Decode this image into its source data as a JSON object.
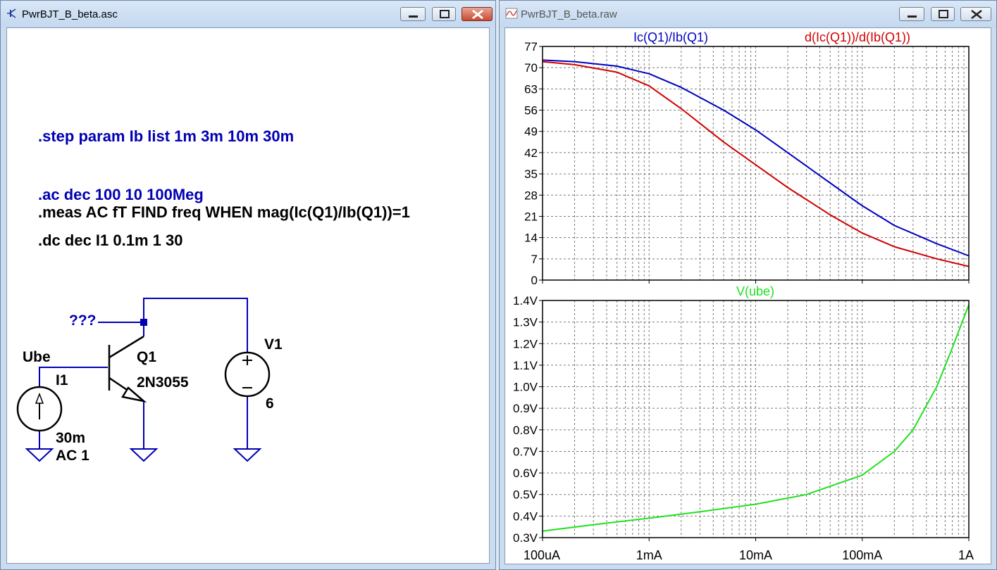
{
  "schematic_window": {
    "title": "PwrBJT_B_beta.asc",
    "directives": {
      "step": ".step param Ib list 1m 3m 10m 30m",
      "ac": ".ac dec 100 10 100Meg",
      "meas": ".meas AC fT FIND freq WHEN mag(Ic(Q1)/Ib(Q1))=1",
      "dc": ".dc dec I1 0.1m 1 30"
    },
    "labels": {
      "net_label": "???",
      "ube_label": "Ube",
      "transistor_ref": "Q1",
      "transistor_model": "2N3055",
      "current_source_ref": "I1",
      "current_source_value": "30m",
      "current_source_ac": "AC 1",
      "voltage_source_ref": "V1",
      "voltage_source_value": "6"
    }
  },
  "waveform_window": {
    "title": "PwrBJT_B_beta.raw",
    "colors": {
      "blue": "#0000c0",
      "red": "#d00000",
      "green": "#20e020",
      "grid": "#7a7a7a"
    }
  },
  "chart_data": [
    {
      "type": "line",
      "x_scale": "log",
      "x_ticks": [
        "100uA",
        "1mA",
        "10mA",
        "100mA",
        "1A"
      ],
      "xlim_A": [
        0.0001,
        1
      ],
      "y_ticks": [
        "0",
        "7",
        "14",
        "21",
        "28",
        "35",
        "42",
        "49",
        "56",
        "63",
        "70",
        "77"
      ],
      "ylim": [
        0,
        77
      ],
      "grid": true,
      "series": [
        {
          "name": "Ic(Q1)/Ib(Q1)",
          "color": "#0000c0",
          "x": [
            0.0001,
            0.0002,
            0.0005,
            0.001,
            0.002,
            0.005,
            0.01,
            0.02,
            0.05,
            0.1,
            0.2,
            0.5,
            1
          ],
          "y": [
            72.5,
            72,
            70.5,
            68,
            63.5,
            56,
            49.5,
            42,
            32,
            24.5,
            18,
            12,
            8
          ]
        },
        {
          "name": "d(Ic(Q1))/d(Ib(Q1))",
          "color": "#d00000",
          "x": [
            0.0001,
            0.0002,
            0.0005,
            0.001,
            0.002,
            0.005,
            0.01,
            0.02,
            0.05,
            0.1,
            0.2,
            0.5,
            1
          ],
          "y": [
            72,
            71,
            68.5,
            64,
            56.5,
            45.5,
            38,
            30.5,
            21.5,
            15.5,
            11,
            7,
            4.5
          ]
        }
      ]
    },
    {
      "type": "line",
      "x_scale": "log",
      "x_ticks": [
        "100uA",
        "1mA",
        "10mA",
        "100mA",
        "1A"
      ],
      "xlim_A": [
        0.0001,
        1
      ],
      "y_ticks": [
        "0.3V",
        "0.4V",
        "0.5V",
        "0.6V",
        "0.7V",
        "0.8V",
        "0.9V",
        "1.0V",
        "1.1V",
        "1.2V",
        "1.3V",
        "1.4V"
      ],
      "ylim": [
        0.3,
        1.4
      ],
      "grid": true,
      "series": [
        {
          "name": "V(ube)",
          "color": "#20e020",
          "x": [
            0.0001,
            0.0003,
            0.001,
            0.003,
            0.01,
            0.03,
            0.1,
            0.2,
            0.3,
            0.5,
            0.7,
            1
          ],
          "y": [
            0.33,
            0.36,
            0.39,
            0.42,
            0.455,
            0.5,
            0.59,
            0.7,
            0.8,
            1.0,
            1.18,
            1.38
          ]
        }
      ]
    }
  ]
}
